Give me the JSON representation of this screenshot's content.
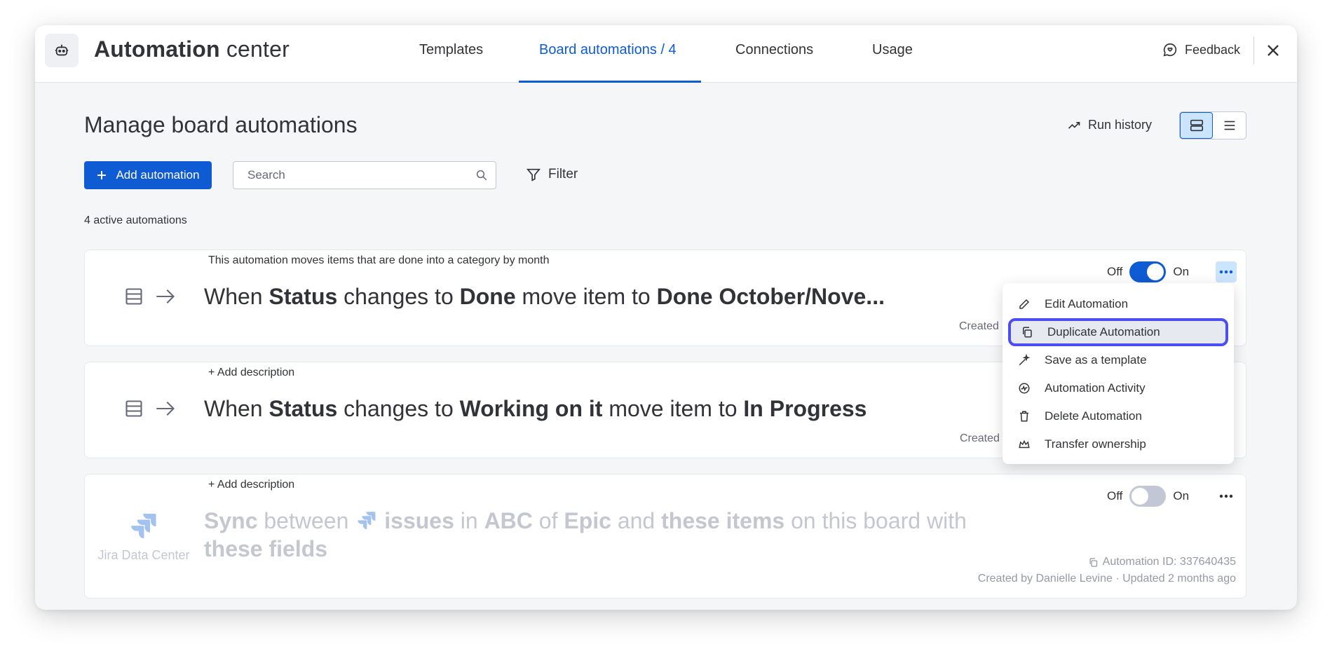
{
  "header": {
    "title_bold": "Automation",
    "title_light": " center",
    "tabs": [
      {
        "label": "Templates"
      },
      {
        "label": "Board automations / 4"
      },
      {
        "label": "Connections"
      },
      {
        "label": "Usage"
      }
    ],
    "feedback_label": "Feedback"
  },
  "page": {
    "title": "Manage board automations",
    "run_history_label": "Run history",
    "add_button_label": "Add automation",
    "search_placeholder": "Search",
    "filter_label": "Filter",
    "active_count": "4 active automations"
  },
  "automations": [
    {
      "description": "This automation moves items that are done into a category by month",
      "parts": [
        "When ",
        "Status",
        " changes to ",
        "Done",
        " move item to ",
        "Done October/Nove..."
      ],
      "status_off": "Off",
      "status_on": "On",
      "enabled": true,
      "created": "Created"
    },
    {
      "description": "+ Add description",
      "parts": [
        "When ",
        "Status",
        " changes to ",
        "Working on it",
        " move item to ",
        "In Progress"
      ],
      "created": "Created"
    },
    {
      "description": "+ Add description",
      "integration_label": "Jira Data Center",
      "line1": [
        "Sync",
        " between ",
        "issues",
        " in ",
        "ABC",
        " of ",
        "Epic",
        " and ",
        "these items",
        " on this board with"
      ],
      "line2": "these fields",
      "status_off": "Off",
      "status_on": "On",
      "enabled": false,
      "automation_id": "Automation ID: 337640435",
      "created_by": "Created by Danielle Levine · Updated 2 months ago"
    }
  ],
  "menu": {
    "items": [
      {
        "label": "Edit Automation",
        "icon": "pencil-icon"
      },
      {
        "label": "Duplicate Automation",
        "icon": "copy-icon"
      },
      {
        "label": "Save as a template",
        "icon": "wand-icon"
      },
      {
        "label": "Automation Activity",
        "icon": "activity-icon"
      },
      {
        "label": "Delete Automation",
        "icon": "trash-icon"
      },
      {
        "label": "Transfer ownership",
        "icon": "crown-icon"
      }
    ],
    "highlighted_index": 1
  },
  "colors": {
    "accent": "#0f5bd3",
    "highlight_border": "#4c4ef2"
  }
}
